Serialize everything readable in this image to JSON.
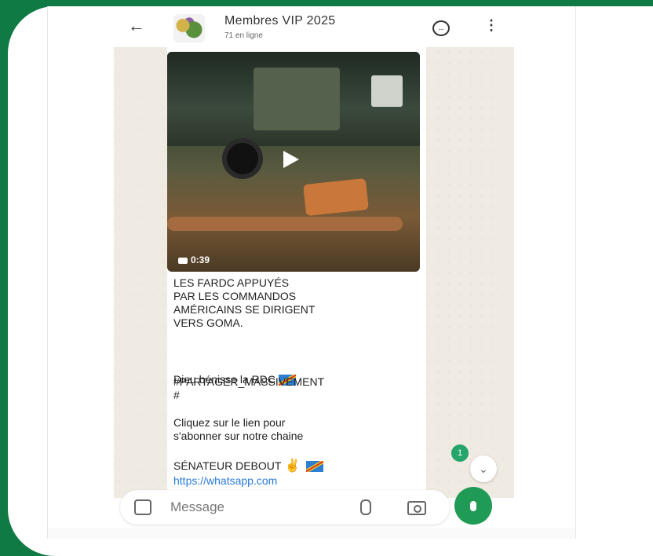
{
  "header": {
    "back_icon": "arrow-left-icon",
    "title": "Membres VIP 2025",
    "subtitle": "71 en ligne",
    "chat_icon": "chat-bubble-icon",
    "more_icon": "more-vertical-icon"
  },
  "message": {
    "video_duration": "0:39",
    "lines": {
      "headline": "LES FARDC APPUYÉS\nPAR LES COMMANDOS\nAMÉRICAINS SE DIRIGENT\nVERS GOMA.",
      "blessing": "Dieu bénisse la RDC",
      "hashtag": "#PARTAGER_MASSIVEMENT\n#",
      "cta": "Cliquez sur le lien pour\ns'abonner sur notre chaine",
      "channel": "SÉNATEUR  DEBOUT",
      "link": "https://whatsapp.com"
    }
  },
  "scroll": {
    "unread_count": "1"
  },
  "composer": {
    "placeholder": "Message"
  },
  "colors": {
    "brand_green": "#1f9b55",
    "background": "#0f7a43",
    "link": "#2a7bd8"
  }
}
